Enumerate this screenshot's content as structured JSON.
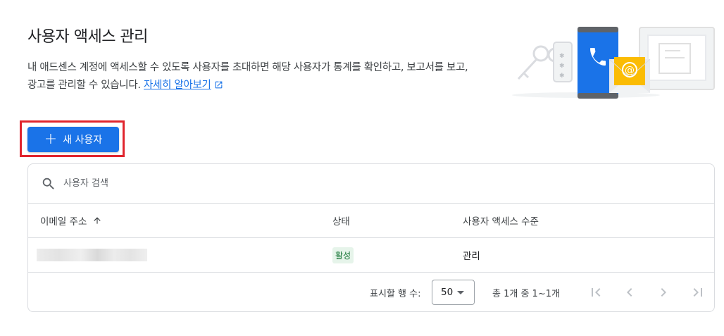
{
  "header": {
    "title": "사용자 액세스 관리",
    "description": "내 애드센스 계정에 액세스할 수 있도록 사용자를 초대하면 해당 사용자가 통계를 확인하고, 보고서를 보고, 광고를 관리할 수 있습니다.",
    "learn_more": "자세히 알아보기"
  },
  "actions": {
    "new_user_label": "새 사용자"
  },
  "search": {
    "placeholder": "사용자 검색"
  },
  "table": {
    "columns": [
      "이메일 주소",
      "상태",
      "사용자 액세스 수준"
    ],
    "rows": [
      {
        "email": "",
        "status": "활성",
        "access": "관리"
      }
    ]
  },
  "pagination": {
    "rows_per_page_label": "표시할 행 수:",
    "rows_per_page_value": "50",
    "range_text": "총 1개 중 1~1개"
  },
  "colors": {
    "primary": "#1a73e8",
    "highlight": "#e0252e",
    "status_active_bg": "#e6f4ea",
    "status_active_text": "#137333"
  }
}
